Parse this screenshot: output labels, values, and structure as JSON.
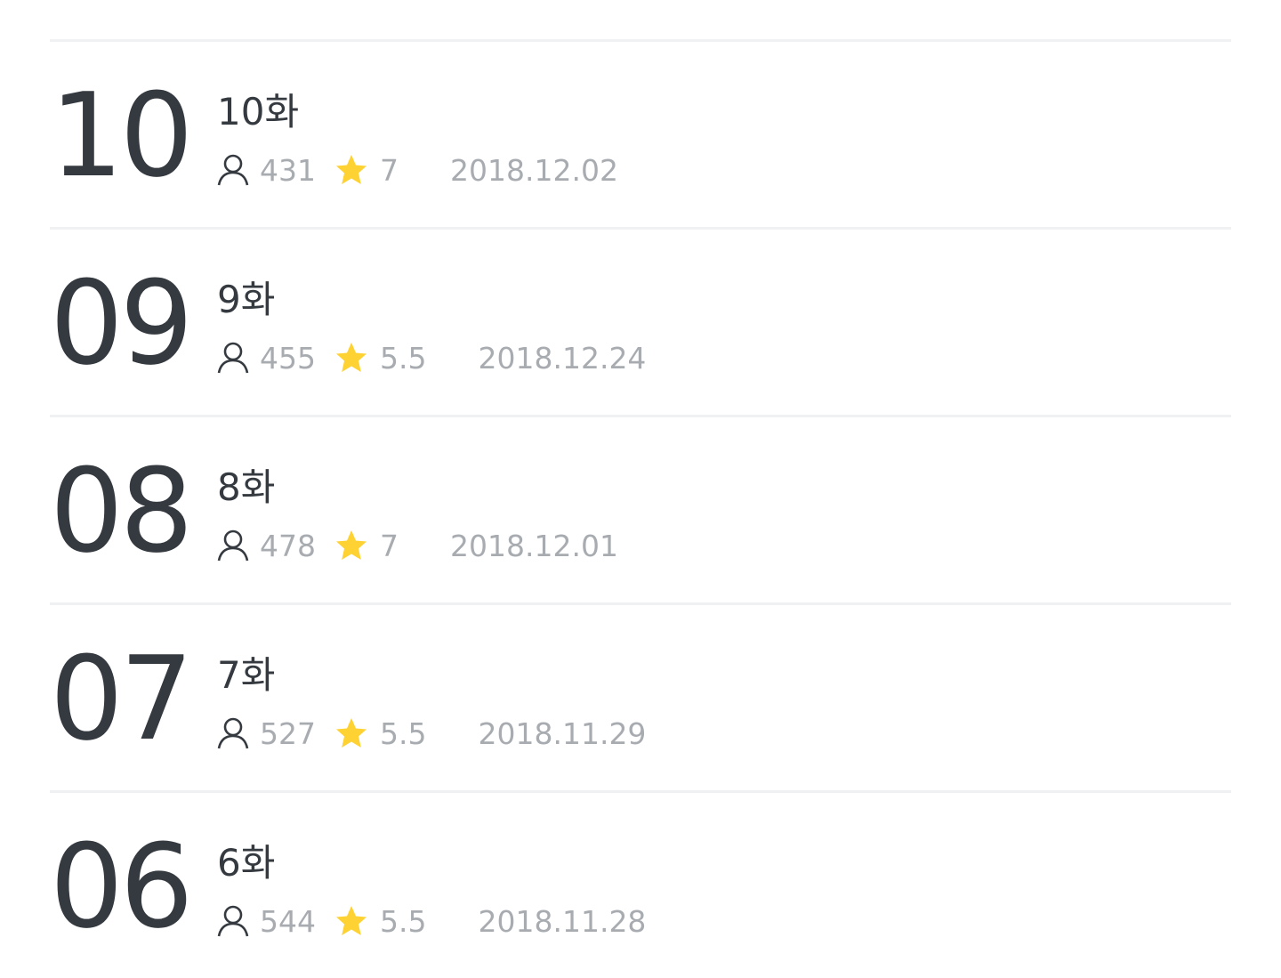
{
  "episodes": [
    {
      "number": "10",
      "title": "10화",
      "views": "431",
      "rating": "7",
      "date": "2018.12.02"
    },
    {
      "number": "09",
      "title": "9화",
      "views": "455",
      "rating": "5.5",
      "date": "2018.12.24"
    },
    {
      "number": "08",
      "title": "8화",
      "views": "478",
      "rating": "7",
      "date": "2018.12.01"
    },
    {
      "number": "07",
      "title": "7화",
      "views": "527",
      "rating": "5.5",
      "date": "2018.11.29"
    },
    {
      "number": "06",
      "title": "6화",
      "views": "544",
      "rating": "5.5",
      "date": "2018.11.28"
    }
  ],
  "icons": {
    "views": "person-icon",
    "rating": "star-icon"
  },
  "colors": {
    "text_primary": "#353a40",
    "text_secondary": "#a8acb1",
    "star": "#ffd233",
    "divider": "#f0f1f2"
  }
}
